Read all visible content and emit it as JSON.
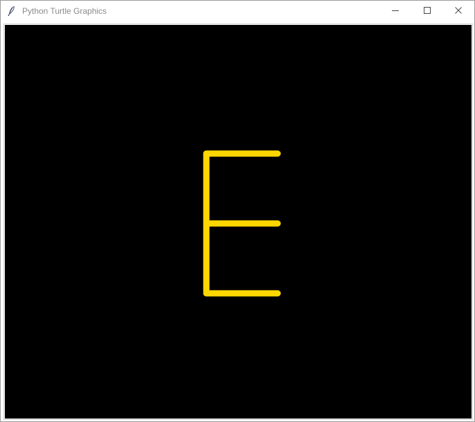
{
  "window": {
    "title": "Python Turtle Graphics",
    "icon": "feather-icon",
    "controls": {
      "minimize_icon": "minimize-icon",
      "maximize_icon": "maximize-icon",
      "close_icon": "close-icon"
    }
  },
  "canvas": {
    "background_color": "#000000",
    "pen_color": "#FFD700",
    "drawing": "letter-E"
  }
}
